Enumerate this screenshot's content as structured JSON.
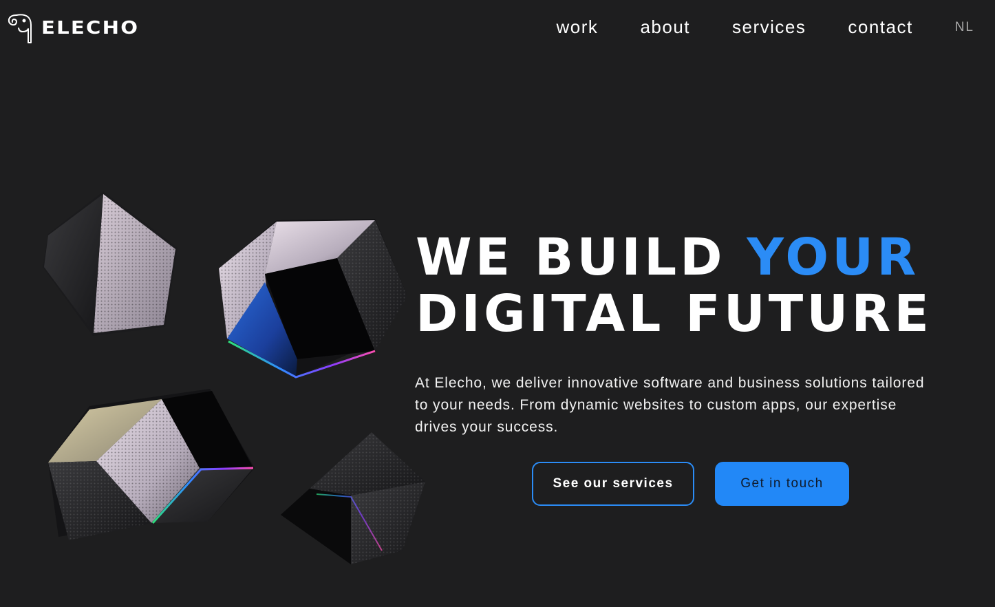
{
  "header": {
    "brand": "ELECHO",
    "logo_icon": "elephant-trunk-icon",
    "nav": [
      {
        "label": "work"
      },
      {
        "label": "about"
      },
      {
        "label": "services"
      },
      {
        "label": "contact"
      }
    ],
    "language": "NL"
  },
  "hero": {
    "headline_part1": "We BUILD ",
    "headline_accent": "your",
    "headline_line2": "DIGITaL FUTUre",
    "description": "At Elecho, we deliver innovative software and business solutions tailored to your needs. From dynamic websites to custom apps, our expertise drives your success.",
    "primary_button": "See our services",
    "secondary_button": "Get in touch",
    "illustration": "floating-metallic-cubes"
  },
  "colors": {
    "background": "#1e1e1f",
    "accent": "#2b8cf6",
    "text": "#ffffff"
  }
}
